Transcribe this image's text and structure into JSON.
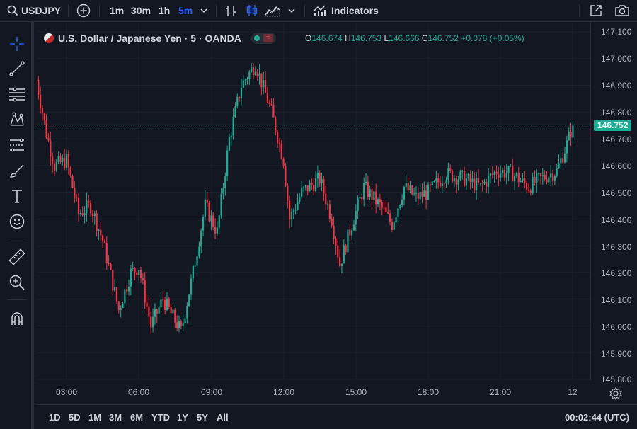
{
  "toolbar": {
    "symbol": "USDJPY",
    "intervals": [
      "1m",
      "30m",
      "1h",
      "5m"
    ],
    "active_interval": "5m",
    "indicators_label": "Indicators",
    "icons": [
      "search-icon",
      "add-symbol-icon",
      "chevron-down-icon",
      "bar-type-icon",
      "candles-icon",
      "area-chart-icon",
      "indicators-icon",
      "open-in-new-window-icon",
      "camera-icon"
    ]
  },
  "legend": {
    "title": "U.S. Dollar / Japanese Yen · 5 · OANDA",
    "o_label": "O",
    "o_value": "146.674",
    "h_label": "H",
    "h_value": "146.753",
    "l_label": "L",
    "l_value": "146.666",
    "c_label": "C",
    "c_value": "146.752",
    "change": "+0.078 (+0.05%)"
  },
  "colors": {
    "background": "#131722",
    "up": "#22ab94",
    "down": "#f23645",
    "grid": "#1e222d",
    "crosshair_price": "#22ab94"
  },
  "price_axis": {
    "labels": [
      "147.100",
      "147.000",
      "146.900",
      "146.800",
      "146.700",
      "146.600",
      "146.500",
      "146.400",
      "146.300",
      "146.200",
      "146.100",
      "146.000",
      "145.900",
      "145.800"
    ],
    "current": "146.752"
  },
  "time_axis": {
    "labels": [
      "03:00",
      "06:00",
      "09:00",
      "12:00",
      "15:00",
      "18:00",
      "21:00",
      "12"
    ],
    "settings_icon": "settings-gear-icon"
  },
  "bottom": {
    "ranges": [
      "1D",
      "5D",
      "1M",
      "3M",
      "6M",
      "YTD",
      "1Y",
      "5Y",
      "All"
    ],
    "clock": "00:02:44 (UTC)"
  },
  "left_tools": [
    "crosshair-icon",
    "trend-line-icon",
    "horizontal-lines-icon",
    "pattern-icon",
    "fib-channel-icon",
    "brush-icon",
    "text-icon",
    "emoji-icon",
    "ruler-icon",
    "zoom-in-icon",
    "magnet-icon"
  ],
  "chart_data": {
    "type": "candlestick",
    "y_range": [
      145.8,
      147.1
    ],
    "x_labels": [
      "03:00",
      "06:00",
      "09:00",
      "12:00",
      "15:00",
      "18:00",
      "21:00",
      "12"
    ],
    "approx_close_path": [
      {
        "x": "01:45",
        "y": 146.92
      },
      {
        "x": "02:10",
        "y": 146.72
      },
      {
        "x": "02:30",
        "y": 146.6
      },
      {
        "x": "03:00",
        "y": 146.62
      },
      {
        "x": "03:30",
        "y": 146.42
      },
      {
        "x": "04:00",
        "y": 146.45
      },
      {
        "x": "04:30",
        "y": 146.32
      },
      {
        "x": "05:10",
        "y": 146.06
      },
      {
        "x": "05:40",
        "y": 146.2
      },
      {
        "x": "06:00",
        "y": 146.22
      },
      {
        "x": "06:30",
        "y": 146.0
      },
      {
        "x": "07:00",
        "y": 146.1
      },
      {
        "x": "07:45",
        "y": 145.98
      },
      {
        "x": "08:15",
        "y": 146.2
      },
      {
        "x": "08:45",
        "y": 146.45
      },
      {
        "x": "09:15",
        "y": 146.35
      },
      {
        "x": "09:45",
        "y": 146.7
      },
      {
        "x": "10:15",
        "y": 146.9
      },
      {
        "x": "10:50",
        "y": 146.98
      },
      {
        "x": "11:30",
        "y": 146.8
      },
      {
        "x": "12:00",
        "y": 146.62
      },
      {
        "x": "12:15",
        "y": 146.4
      },
      {
        "x": "12:45",
        "y": 146.5
      },
      {
        "x": "13:30",
        "y": 146.55
      },
      {
        "x": "14:00",
        "y": 146.4
      },
      {
        "x": "14:20",
        "y": 146.23
      },
      {
        "x": "14:50",
        "y": 146.38
      },
      {
        "x": "15:20",
        "y": 146.52
      },
      {
        "x": "16:00",
        "y": 146.45
      },
      {
        "x": "16:30",
        "y": 146.38
      },
      {
        "x": "17:00",
        "y": 146.52
      },
      {
        "x": "17:30",
        "y": 146.48
      },
      {
        "x": "18:00",
        "y": 146.5
      },
      {
        "x": "18:45",
        "y": 146.57
      },
      {
        "x": "19:30",
        "y": 146.55
      },
      {
        "x": "20:10",
        "y": 146.52
      },
      {
        "x": "20:50",
        "y": 146.58
      },
      {
        "x": "21:30",
        "y": 146.57
      },
      {
        "x": "22:10",
        "y": 146.52
      },
      {
        "x": "22:40",
        "y": 146.55
      },
      {
        "x": "23:20",
        "y": 146.58
      },
      {
        "x": "23:45",
        "y": 146.68
      },
      {
        "x": "00:00",
        "y": 146.752
      }
    ]
  }
}
